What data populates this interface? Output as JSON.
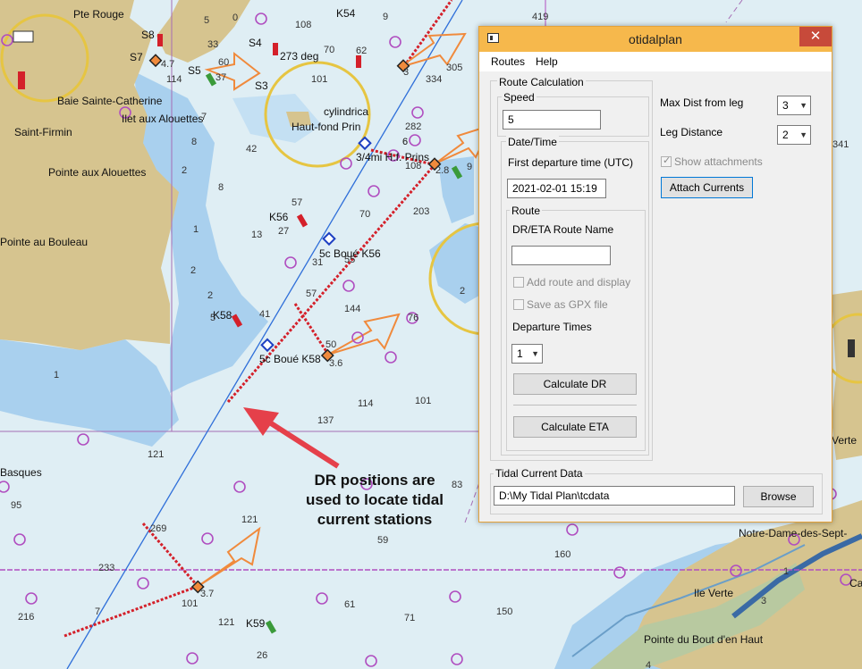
{
  "dialog": {
    "title": "otidalplan",
    "close_glyph": "✕",
    "menu": {
      "routes": "Routes",
      "help": "Help"
    },
    "route_calc_label": "Route Calculation",
    "speed": {
      "label": "Speed",
      "value": "5"
    },
    "datetime": {
      "label": "Date/Time",
      "first_departure_label": "First departure time (UTC)",
      "value": "2021-02-01  15:19"
    },
    "route": {
      "label": "Route",
      "name_label": "DR/ETA Route Name",
      "name_value": "",
      "add_route_label": "Add route and display",
      "save_gpx_label": "Save as GPX file",
      "departure_times_label": "Departure Times",
      "departure_times_value": "1",
      "calc_dr": "Calculate DR",
      "calc_eta": "Calculate ETA"
    },
    "max_dist": {
      "label": "Max Dist from leg",
      "value": "3"
    },
    "leg_distance": {
      "label": "Leg Distance",
      "value": "2"
    },
    "show_attachments": {
      "label": "Show attachments",
      "checked": true
    },
    "attach_currents": "Attach Currents",
    "tidal_current": {
      "label": "Tidal Current Data",
      "path": "D:\\My Tidal Plan\\tcdata",
      "browse": "Browse"
    }
  },
  "annotation": {
    "line1": "DR positions  are",
    "line2": "used to locate tidal",
    "line3": "current stations"
  },
  "map": {
    "place_names": [
      "Pte Rouge",
      "Baie Sainte-Catherine",
      "Ilet aux Alouettes",
      "Saint-Firmin",
      "Pointe aux Alouettes",
      "Pointe au Bouleau",
      "Basques",
      "Notre-Dame-des-Sept-",
      "Ile Verte",
      "Pointe du Bout d'en Haut",
      "Verte",
      "Ca"
    ],
    "markers": [
      "S8",
      "S7",
      "S5",
      "S4",
      "S3",
      "K54",
      "K56",
      "K58",
      "K59",
      "273 deg",
      "cylindrica",
      "Haut-fond Prin",
      "3/4mi H.f. Prins",
      "5c Boué K56",
      "5c Boué K58"
    ],
    "dr_values": [
      "4.7",
      "3",
      "2.8",
      "3.6",
      "3.7"
    ],
    "depths": [
      "5",
      "0",
      "108",
      "70",
      "62",
      "9",
      "33",
      "60",
      "37",
      "101",
      "7",
      "114",
      "6",
      "282",
      "8",
      "42",
      "108",
      "2",
      "8",
      "9",
      "57",
      "70",
      "203",
      "13",
      "27",
      "1",
      "2",
      "2",
      "5",
      "31",
      "55",
      "57",
      "144",
      "76",
      "41",
      "50",
      "1",
      "114",
      "101",
      "137",
      "121",
      "95",
      "269",
      "121",
      "59",
      "233",
      "7",
      "216",
      "101",
      "121",
      "61",
      "71",
      "150",
      "26",
      "160",
      "1",
      "3",
      "4",
      "341",
      "419",
      "305",
      "334",
      "83",
      "2",
      "6"
    ]
  }
}
